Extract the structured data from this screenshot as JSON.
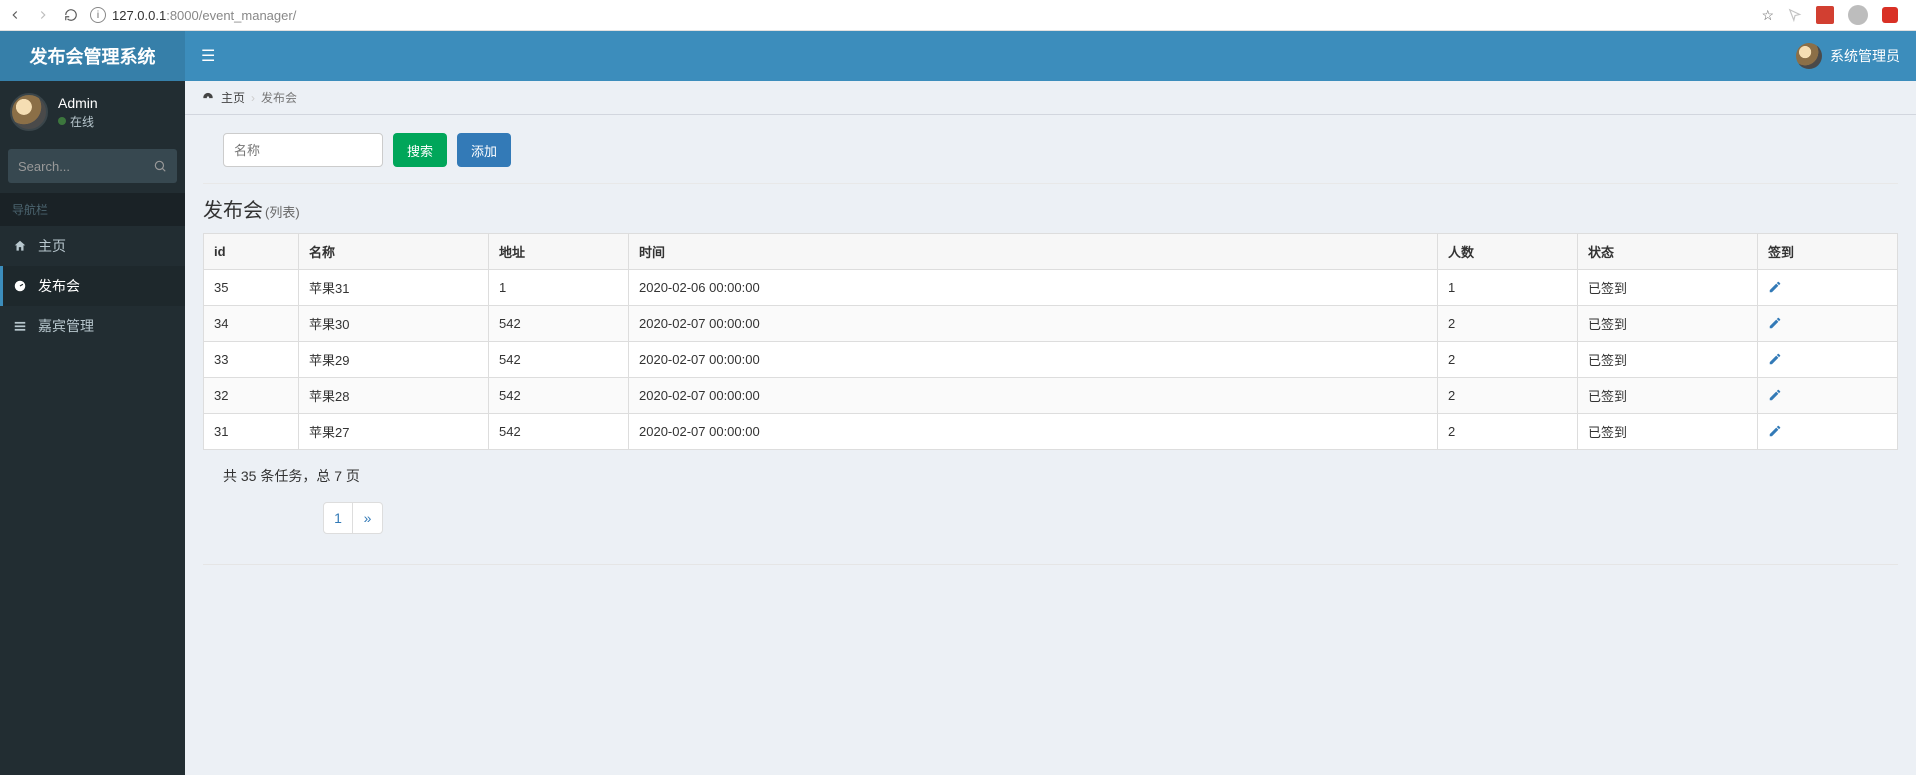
{
  "browser": {
    "url_prefix": "127.0.0.1",
    "url_suffix": ":8000/event_manager/"
  },
  "app": {
    "title": "发布会管理系统"
  },
  "sidebar": {
    "user": {
      "name": "Admin",
      "status": "在线"
    },
    "search_placeholder": "Search...",
    "nav_header": "导航栏",
    "items": [
      {
        "icon": "home",
        "label": "主页"
      },
      {
        "icon": "dashboard",
        "label": "发布会"
      },
      {
        "icon": "list",
        "label": "嘉宾管理"
      }
    ]
  },
  "topbar": {
    "user_label": "系统管理员"
  },
  "breadcrumb": {
    "home": "主页",
    "current": "发布会"
  },
  "search_form": {
    "placeholder": "名称",
    "search_btn": "搜索",
    "add_btn": "添加"
  },
  "section": {
    "title": "发布会",
    "subtitle": "(列表)"
  },
  "table": {
    "columns": [
      "id",
      "名称",
      "地址",
      "时间",
      "人数",
      "状态",
      "签到"
    ],
    "rows": [
      {
        "id": "35",
        "name": "苹果31",
        "address": "1",
        "time": "2020-02-06 00:00:00",
        "count": "1",
        "status": "已签到"
      },
      {
        "id": "34",
        "name": "苹果30",
        "address": "542",
        "time": "2020-02-07 00:00:00",
        "count": "2",
        "status": "已签到"
      },
      {
        "id": "33",
        "name": "苹果29",
        "address": "542",
        "time": "2020-02-07 00:00:00",
        "count": "2",
        "status": "已签到"
      },
      {
        "id": "32",
        "name": "苹果28",
        "address": "542",
        "time": "2020-02-07 00:00:00",
        "count": "2",
        "status": "已签到"
      },
      {
        "id": "31",
        "name": "苹果27",
        "address": "542",
        "time": "2020-02-07 00:00:00",
        "count": "2",
        "status": "已签到"
      }
    ]
  },
  "footer": {
    "summary": "共 35 条任务，总 7 页",
    "page1": "1",
    "next": "»"
  }
}
